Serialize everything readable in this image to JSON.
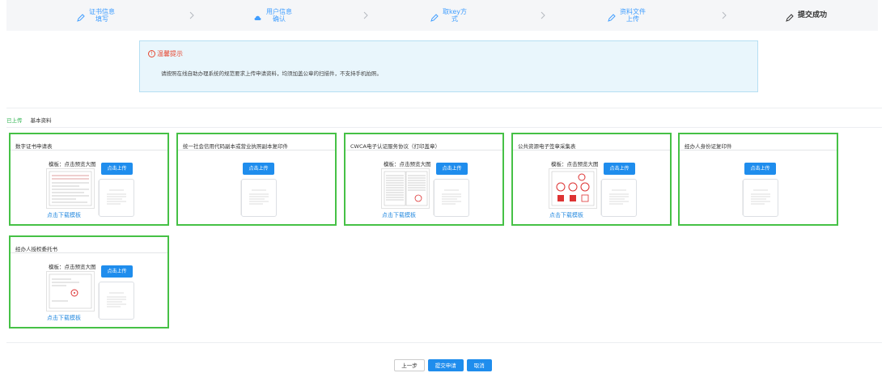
{
  "steps": [
    {
      "line1": "证书信息",
      "line2": "填写"
    },
    {
      "line1": "用户信息",
      "line2": "确认"
    },
    {
      "line1": "取key方",
      "line2": "式"
    },
    {
      "line1": "资料文件",
      "line2": "上传"
    },
    {
      "line1": "提交成功",
      "line2": ""
    }
  ],
  "notice": {
    "title": "温馨提示",
    "text": "请按照在线自助办理系统的规范要求上传申请资料，均须加盖公章的扫描件，不支持手机拍照。"
  },
  "tabs": [
    "已上传",
    "基本资料"
  ],
  "cards": [
    {
      "title": "数字证书申请表",
      "template_label": "模板：点击预览大图",
      "download": "点击下载模板",
      "upload": "点击上传"
    },
    {
      "title": "统一社会信用代码副本或营业执照副本复印件",
      "upload": "点击上传"
    },
    {
      "title": "CWCA电子认证服务协议（打印盖章）",
      "template_label": "模板：点击预览大图",
      "download": "点击下载模板",
      "upload": "点击上传"
    },
    {
      "title": "公共资源电子签章采集表",
      "template_label": "模板：点击预览大图",
      "download": "点击下载模板",
      "upload": "点击上传"
    },
    {
      "title": "经办人身份证复印件",
      "upload": "点击上传"
    },
    {
      "title": "经办人授权委托书",
      "template_label": "模板：点击预览大图",
      "download": "点击下载模板",
      "upload": "点击上传"
    }
  ],
  "buttons": {
    "prev": "上一步",
    "submit": "提交申请",
    "cancel": "取消"
  },
  "colors": {
    "accent": "#1f8ded",
    "border_ok": "#46c146",
    "warn": "#e6472f"
  }
}
